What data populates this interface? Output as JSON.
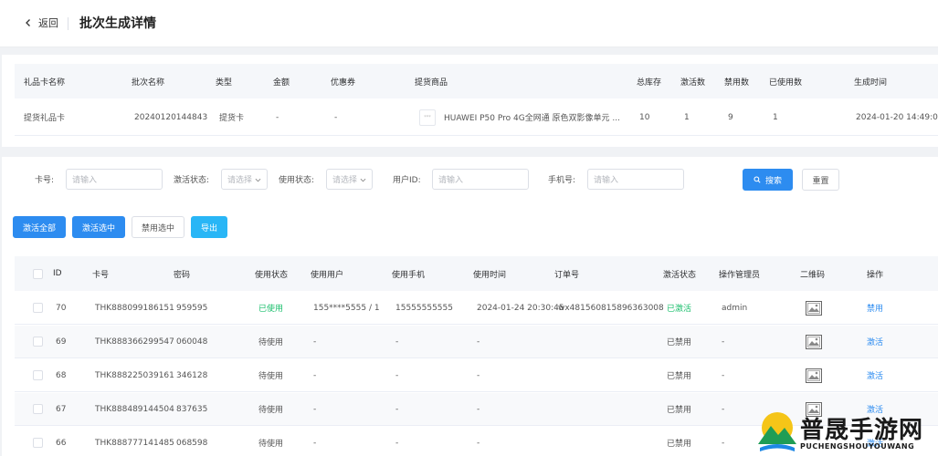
{
  "header": {
    "back_label": "返回",
    "title": "批次生成详情"
  },
  "batch_info": {
    "columns": [
      "礼品卡名称",
      "批次名称",
      "类型",
      "金额",
      "优惠券",
      "提货商品",
      "总库存",
      "激活数",
      "禁用数",
      "已使用数",
      "生成时间"
    ],
    "row": {
      "card_name": "提货礼品卡",
      "batch_name": "20240120144843",
      "type": "提货卡",
      "amount": "-",
      "coupon": "-",
      "goods_thumb": "***",
      "goods": "HUAWEI P50 Pro 4G全网通 原色双影像单元 ...",
      "total_stock": "10",
      "activated": "1",
      "disabled": "9",
      "used": "1",
      "created_at": "2024-01-20 14:49:00"
    }
  },
  "filters": {
    "card_no_label": "卡号:",
    "card_no_placeholder": "请输入",
    "activation_label": "激活状态:",
    "activation_placeholder": "请选择",
    "usage_label": "使用状态:",
    "usage_placeholder": "请选择",
    "user_id_label": "用户ID:",
    "user_id_placeholder": "请输入",
    "phone_label": "手机号:",
    "phone_placeholder": "请输入",
    "search_label": "搜索",
    "reset_label": "重置"
  },
  "actions": {
    "activate_all": "激活全部",
    "activate_selected": "激活选中",
    "disable_selected": "禁用选中",
    "export": "导出"
  },
  "table": {
    "columns": [
      "ID",
      "卡号",
      "密码",
      "使用状态",
      "使用用户",
      "使用手机",
      "使用时间",
      "订单号",
      "激活状态",
      "操作管理员",
      "二维码",
      "操作"
    ],
    "rows": [
      {
        "id": "70",
        "card_no": "THK888099186151",
        "password": "959595",
        "use_status": "已使用",
        "user": "155****5555 / 1",
        "phone": "15555555555",
        "time": "2024-01-24 20:30:45",
        "order": "wx481560815896363008",
        "act_status": "已激活",
        "admin": "admin",
        "op": "禁用"
      },
      {
        "id": "69",
        "card_no": "THK888366299547",
        "password": "060048",
        "use_status": "待使用",
        "user": "-",
        "phone": "-",
        "time": "-",
        "order": "",
        "act_status": "已禁用",
        "admin": "-",
        "op": "激活"
      },
      {
        "id": "68",
        "card_no": "THK888225039161",
        "password": "346128",
        "use_status": "待使用",
        "user": "-",
        "phone": "-",
        "time": "-",
        "order": "",
        "act_status": "已禁用",
        "admin": "-",
        "op": "激活"
      },
      {
        "id": "67",
        "card_no": "THK888489144504",
        "password": "837635",
        "use_status": "待使用",
        "user": "-",
        "phone": "-",
        "time": "-",
        "order": "",
        "act_status": "已禁用",
        "admin": "-",
        "op": "激活"
      },
      {
        "id": "66",
        "card_no": "THK888777141485",
        "password": "068598",
        "use_status": "待使用",
        "user": "-",
        "phone": "-",
        "time": "-",
        "order": "",
        "act_status": "已禁用",
        "admin": "-",
        "op": "激活"
      }
    ]
  },
  "watermark": {
    "title": "普晟手游网",
    "subtitle": "PUCHENGSHOUYOUWANG"
  },
  "colors": {
    "primary": "#2d8cf0",
    "cyan": "#29b6f6",
    "success": "#19be6b"
  }
}
